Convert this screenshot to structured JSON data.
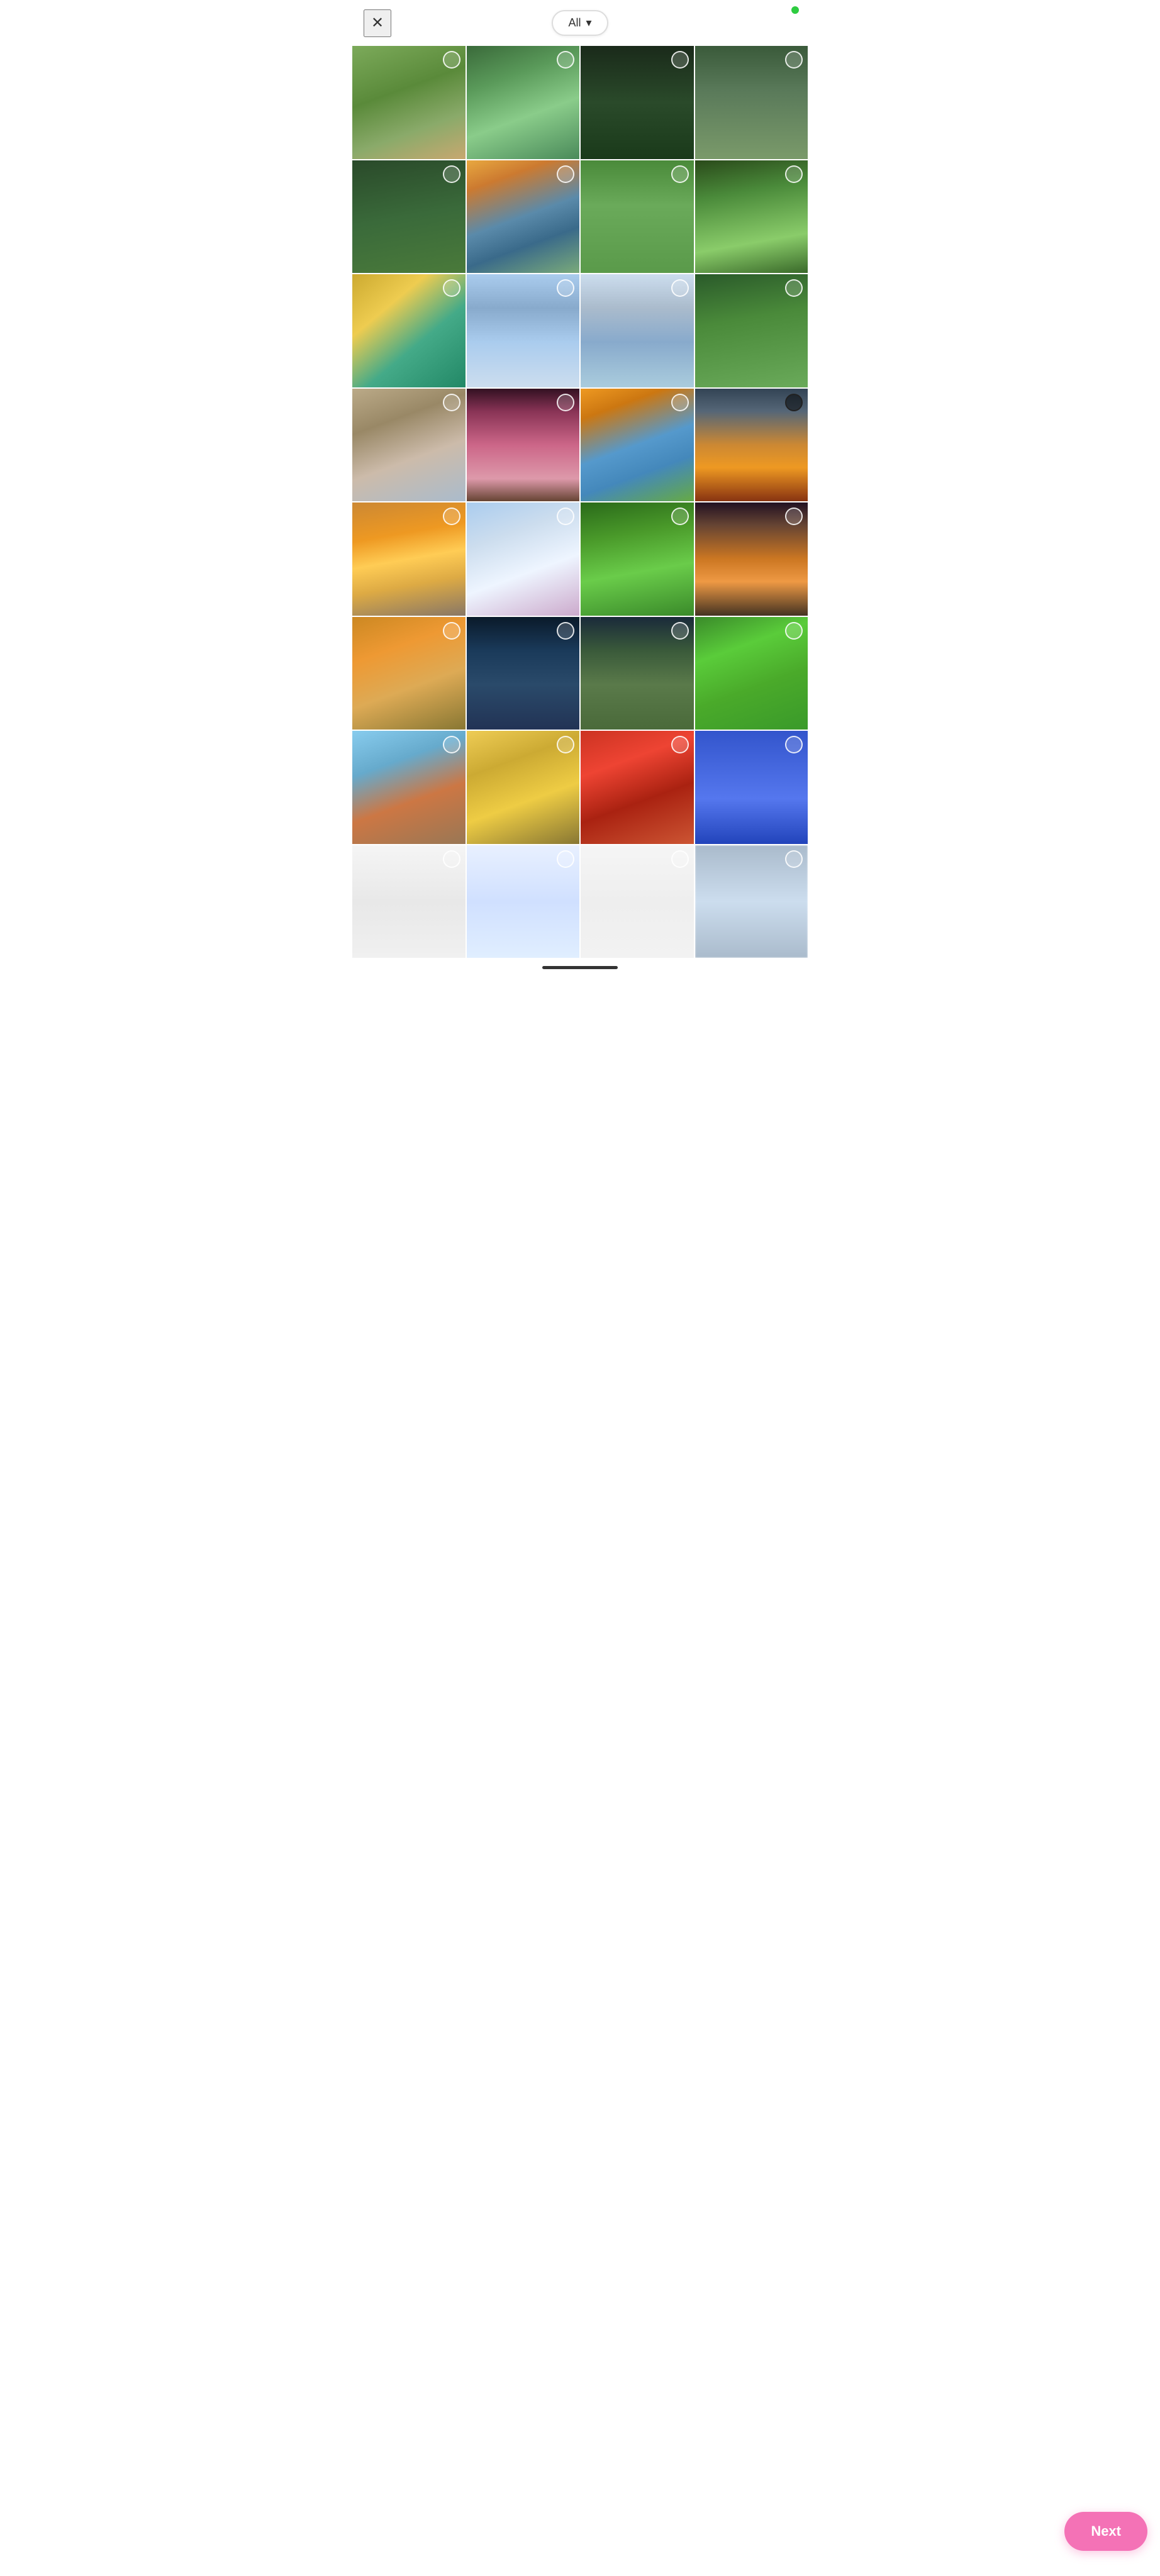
{
  "header": {
    "filter_label": "All",
    "chevron": "▾",
    "close_icon": "✕"
  },
  "status": {
    "dot_color": "#2ecc40"
  },
  "grid": {
    "cells": [
      {
        "id": 0,
        "bg": "img-hiker-meadow",
        "selected": false
      },
      {
        "id": 1,
        "bg": "img-hiker-waterfall",
        "selected": false
      },
      {
        "id": 2,
        "bg": "img-dark-forest",
        "selected": false
      },
      {
        "id": 3,
        "bg": "img-bridge-hiker",
        "selected": false
      },
      {
        "id": 4,
        "bg": "img-forest-walk",
        "selected": false
      },
      {
        "id": 5,
        "bg": "img-mountain-lake",
        "selected": false
      },
      {
        "id": 6,
        "bg": "img-green-path",
        "selected": false
      },
      {
        "id": 7,
        "bg": "img-sunbeam-forest",
        "selected": false
      },
      {
        "id": 8,
        "bg": "img-butterfly",
        "selected": false
      },
      {
        "id": 9,
        "bg": "img-dock-reflection",
        "selected": false
      },
      {
        "id": 10,
        "bg": "img-mountain-lake2",
        "selected": false
      },
      {
        "id": 11,
        "bg": "img-tall-forest",
        "selected": false
      },
      {
        "id": 12,
        "bg": "img-cliffside",
        "selected": false
      },
      {
        "id": 13,
        "bg": "img-pink-sunset-tree",
        "selected": false
      },
      {
        "id": 14,
        "bg": "img-autumn-lake",
        "selected": false
      },
      {
        "id": 15,
        "bg": "img-sunset-lake",
        "selected": true
      },
      {
        "id": 16,
        "bg": "img-road-sunset",
        "selected": false
      },
      {
        "id": 17,
        "bg": "img-bird-blossom",
        "selected": false
      },
      {
        "id": 18,
        "bg": "img-green-canopy",
        "selected": false
      },
      {
        "id": 19,
        "bg": "img-sunset-tree2",
        "selected": false
      },
      {
        "id": 20,
        "bg": "img-forest-path",
        "selected": false
      },
      {
        "id": 21,
        "bg": "img-lantern-moon",
        "selected": false
      },
      {
        "id": 22,
        "bg": "img-tree-sunset3",
        "selected": false
      },
      {
        "id": 23,
        "bg": "img-mossy-stream",
        "selected": false
      },
      {
        "id": 24,
        "bg": "img-mountain-lake3",
        "selected": false
      },
      {
        "id": 25,
        "bg": "img-aspen-path",
        "selected": false
      },
      {
        "id": 26,
        "bg": "img-red-autumn",
        "selected": false
      },
      {
        "id": 27,
        "bg": "img-form-blue",
        "selected": false
      },
      {
        "id": 28,
        "bg": "img-doc1",
        "selected": false
      },
      {
        "id": 29,
        "bg": "img-doc2",
        "selected": false
      },
      {
        "id": 30,
        "bg": "img-doc3",
        "selected": false
      },
      {
        "id": 31,
        "bg": "img-blurred",
        "selected": false
      }
    ]
  },
  "next_button": {
    "label": "Next"
  },
  "bottom_indicator": {}
}
